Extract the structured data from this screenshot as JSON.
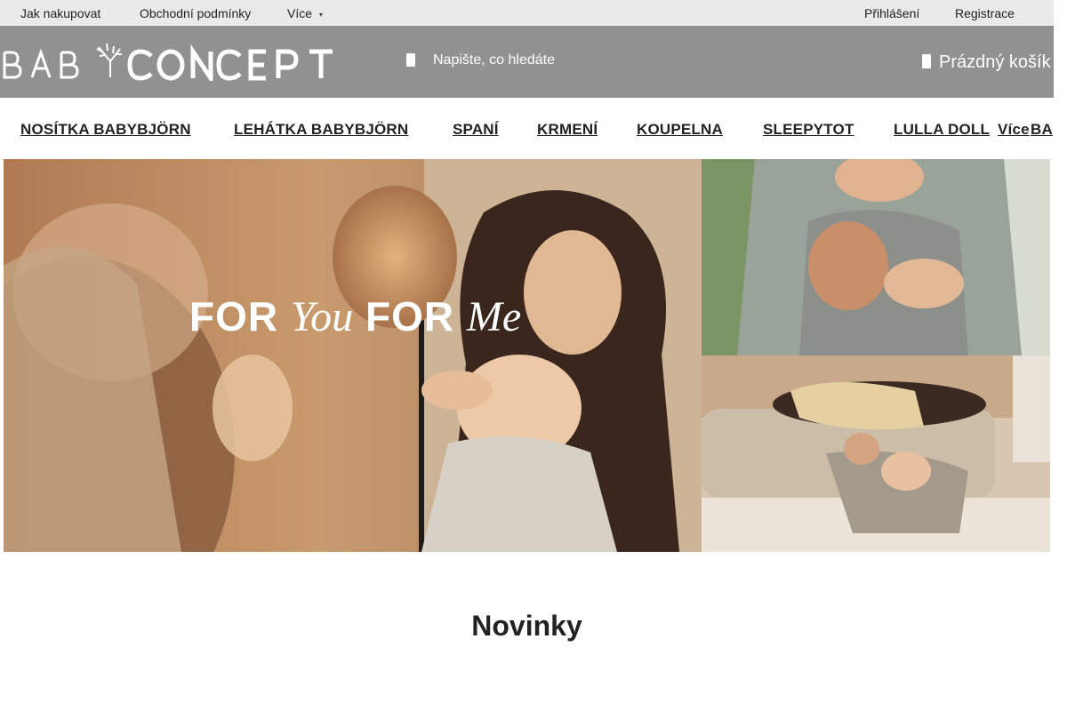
{
  "topbar": {
    "links": [
      "Jak nakupovat",
      "Obchodní podmínky",
      "Více"
    ],
    "login": "Přihlášení",
    "register": "Registrace"
  },
  "header": {
    "logo_text": "BABYCONCEPT",
    "search": {
      "placeholder": "Napište, co hledáte",
      "icon": "search-icon"
    },
    "cart": {
      "label": "Prázdný košík",
      "icon": "cart-icon"
    }
  },
  "nav": {
    "items": [
      "NOSÍTKA BABYBJÖRN",
      "LEHÁTKA BABYBJÖRN",
      "SPANÍ",
      "KRMENÍ",
      "KOUPELNA",
      "SLEEPYTOT",
      "LULLA DOLL",
      "Více",
      "BA"
    ]
  },
  "banner": {
    "title_parts": [
      "FOR",
      "You",
      "FOR",
      "Me"
    ]
  },
  "section": {
    "title": "Novinky"
  },
  "colors": {
    "header_bg": "#919191",
    "topbar_bg": "#eaeaea",
    "text": "#222222"
  }
}
